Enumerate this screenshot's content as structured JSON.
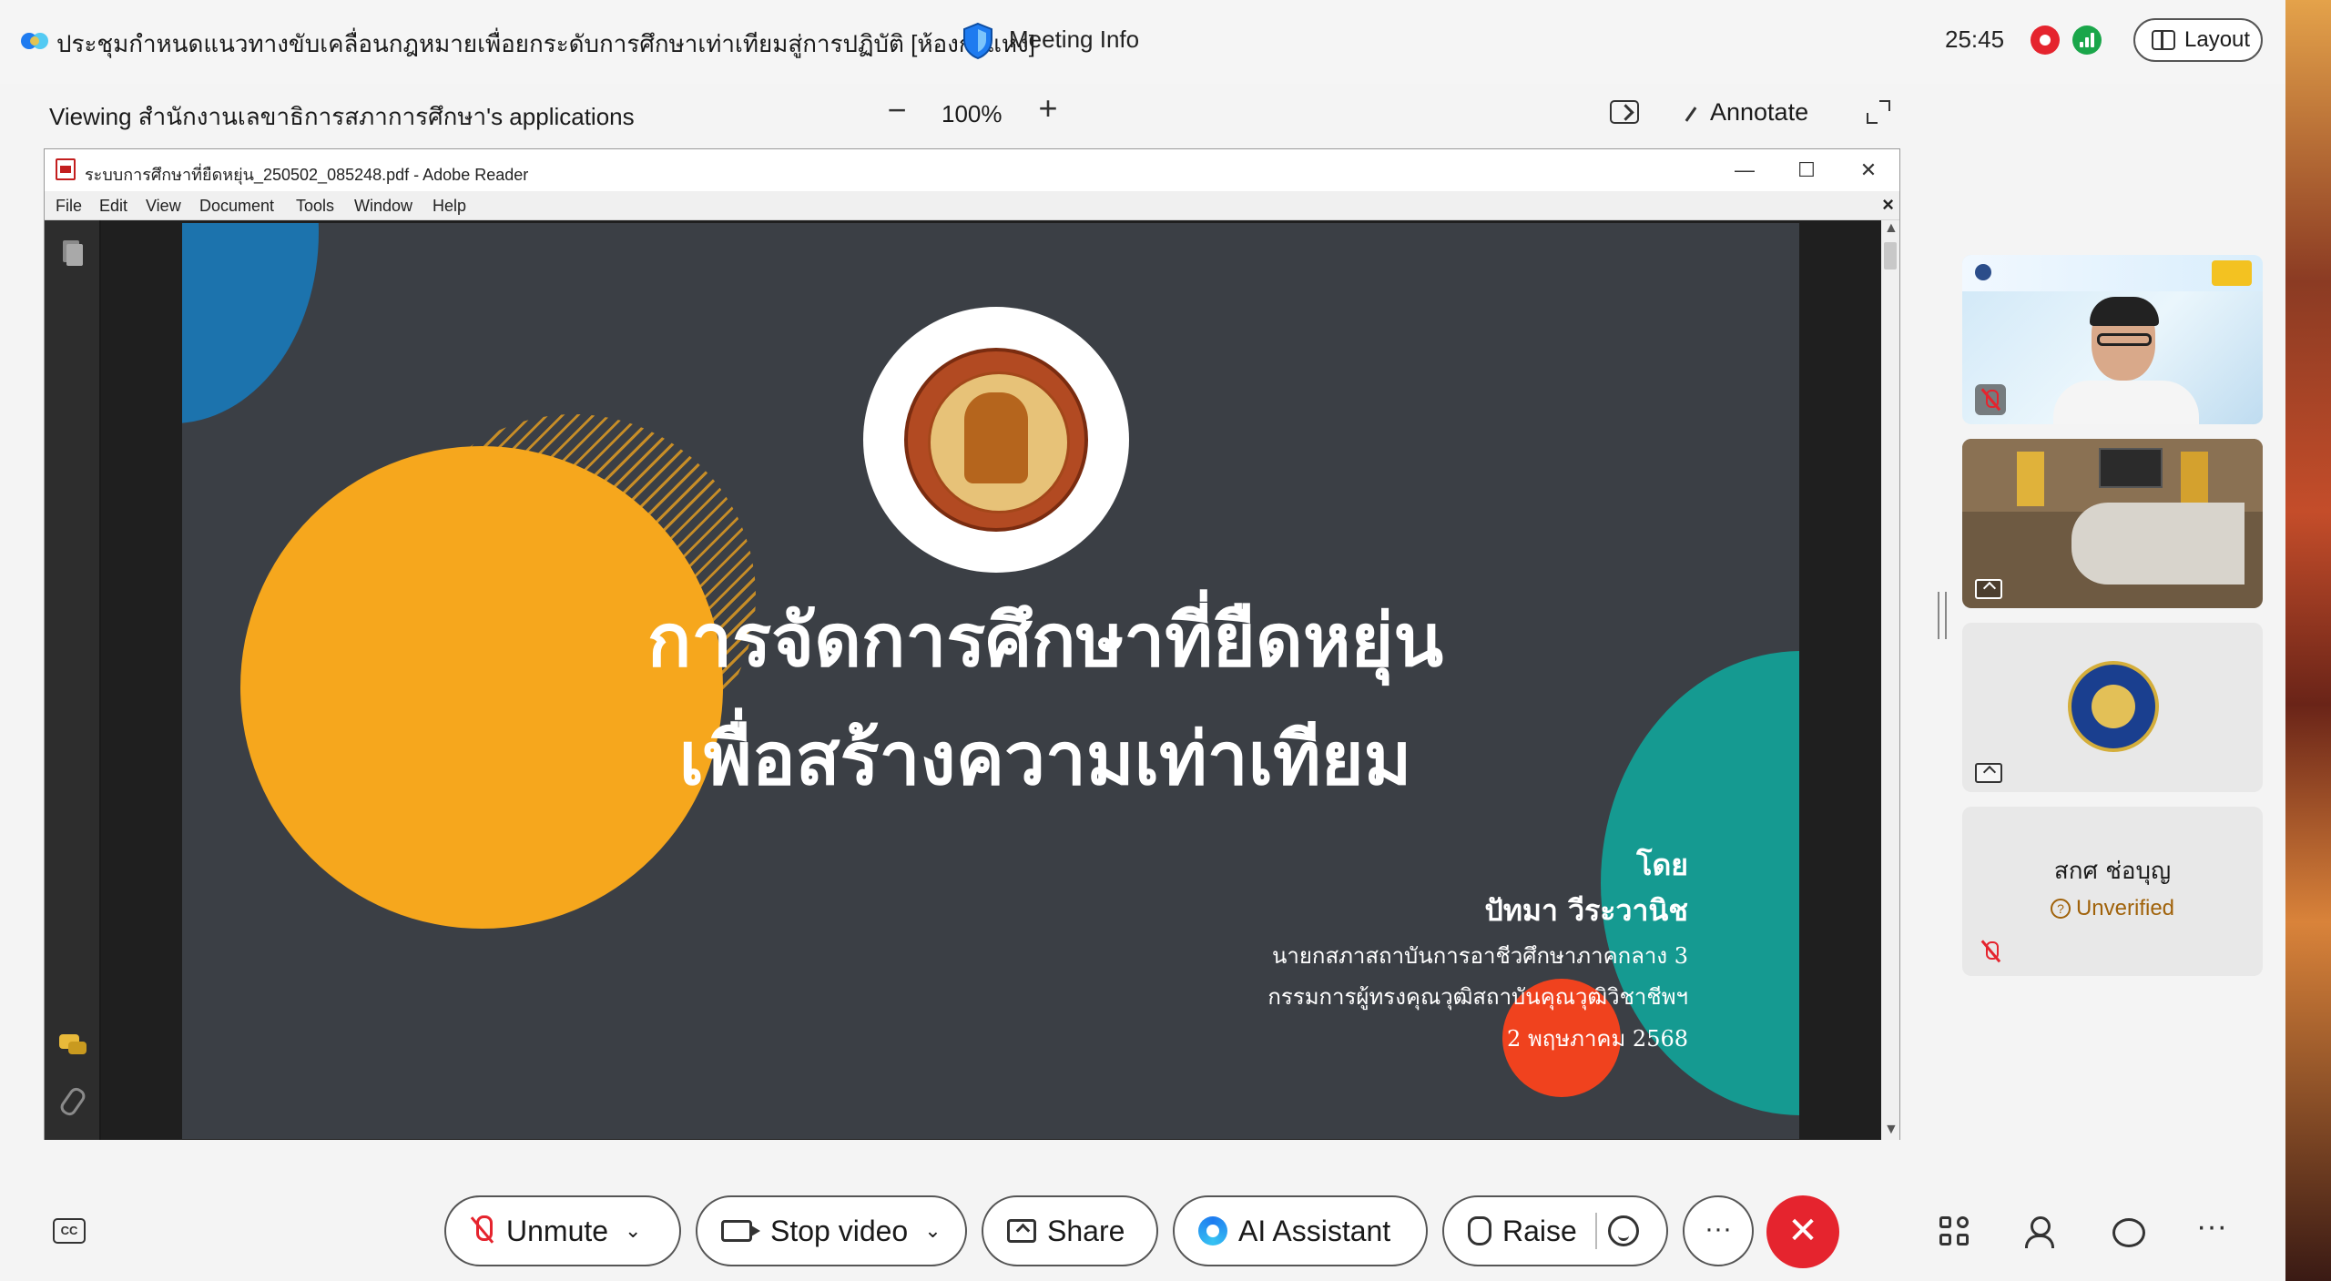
{
  "topbar": {
    "meeting_title": "ประชุมกำหนดแนวทางขับเคลื่อนกฎหมายเพื่อยกระดับการศึกษาเท่าเทียมสู่การปฏิบัติ [ห้องกำแหง]",
    "meeting_info": "Meeting Info",
    "timer": "25:45",
    "layout_label": "Layout"
  },
  "viewer": {
    "viewing_label": "Viewing สำนักงานเลขาธิการสภาการศึกษา's applications",
    "zoom_out": "−",
    "zoom_value": "100%",
    "zoom_in": "+",
    "annotate_label": "Annotate"
  },
  "reader": {
    "window_title": "ระบบการศึกษาที่ยืดหยุ่น_250502_085248.pdf - Adobe Reader",
    "minimize": "—",
    "maximize": "☐",
    "close": "✕",
    "menu": [
      "File",
      "Edit",
      "View",
      "Document",
      "Tools",
      "Window",
      "Help"
    ],
    "menu_close": "×",
    "scroll_up": "▲",
    "scroll_down": "▼"
  },
  "slide": {
    "title_line1": "การจัดการศึกษาที่ยืดหยุ่น",
    "title_line2": "เพื่อสร้างความเท่าเทียม",
    "by": "โดย",
    "speaker": "ปัทมา วีระวานิช",
    "role1": "นายกสภาสถาบันการอาชีวศึกษาภาคกลาง 3",
    "role2": "กรรมการผู้ทรงคุณวุฒิสถาบันคุณวุฒิวิชาชีพฯ",
    "date": "2 พฤษภาคม 2568"
  },
  "participants": {
    "p4_name": "สกศ ช่อบุญ",
    "p4_status": "Unverified",
    "warn_glyph": "?"
  },
  "toolbar": {
    "cc": "CC",
    "unmute": "Unmute",
    "stop_video": "Stop video",
    "share": "Share",
    "ai_assistant": "AI Assistant",
    "raise": "Raise",
    "more_center": "···",
    "end": "✕",
    "more_right": "···",
    "chevron": "⌄"
  },
  "colors": {
    "accent_red": "#e5242e",
    "slide_bg": "#3b3f45",
    "slide_orange": "#f6a71d",
    "slide_teal": "#159a91",
    "slide_blue": "#1c73ad",
    "unverified": "#a0620a"
  }
}
